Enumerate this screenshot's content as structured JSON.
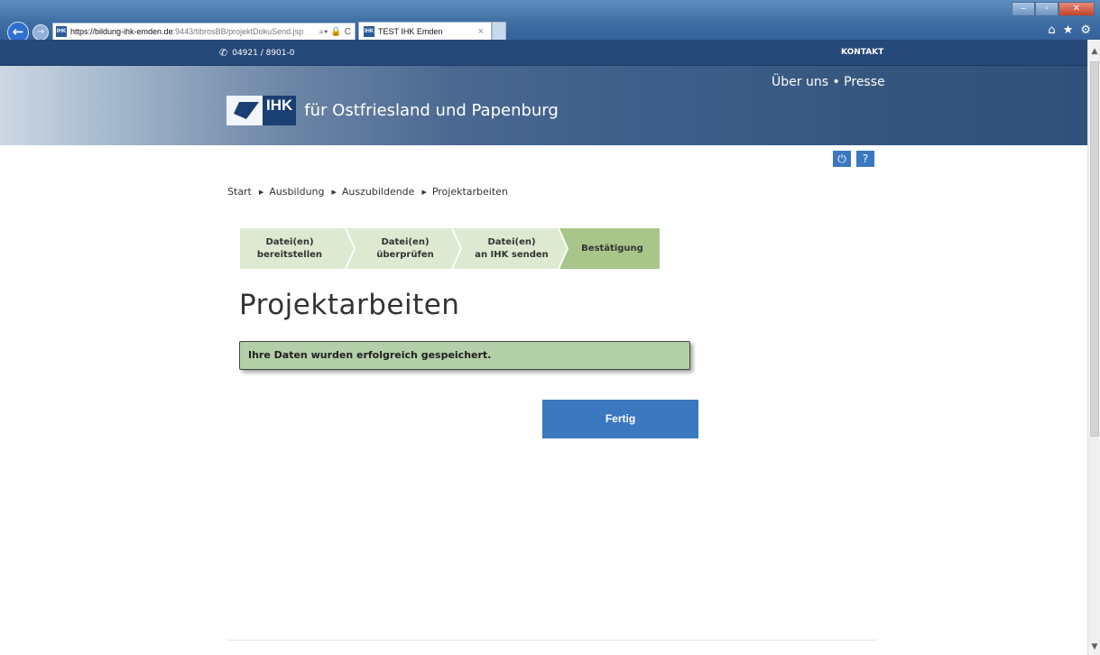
{
  "browser": {
    "url_host": "https://bildung-ihk-emden.de",
    "url_path": ":9443/tibrosBB/projektDokuSend.jsp",
    "site_favicon": "IHK",
    "tab_title": "TEST IHK Emden",
    "tab_close": "×",
    "address_tools": [
      "⌕▾",
      "🔒",
      "C"
    ],
    "window_buttons": [
      "–",
      "▫",
      "✕"
    ],
    "tool_icons": [
      "home-icon",
      "star-icon",
      "gear-icon"
    ],
    "tool_glyphs": [
      "⌂",
      "★",
      "⚙"
    ]
  },
  "topbar": {
    "phone": "04921 / 8901-0",
    "kontakt": "KONTAKT"
  },
  "header": {
    "logo_abbr": "IHK",
    "logo_text": "für Ostfriesland und Papenburg",
    "link_about": "Über uns",
    "link_sep": " • ",
    "link_press": "Presse"
  },
  "util": {
    "power_icon": "⏻",
    "help_icon": "?"
  },
  "breadcrumb": [
    "Start",
    "Ausbildung",
    "Auszubildende",
    "Projektarbeiten"
  ],
  "steps": [
    {
      "line1": "Datei(en)",
      "line2": "bereitstellen",
      "active": false
    },
    {
      "line1": "Datei(en)",
      "line2": "überprüfen",
      "active": false
    },
    {
      "line1": "Datei(en)",
      "line2": "an IHK senden",
      "active": false
    },
    {
      "line1": "Bestätigung",
      "line2": "",
      "active": true
    }
  ],
  "main": {
    "title": "Projektarbeiten",
    "success_message": "Ihre Daten wurden erfolgreich gespeichert.",
    "fertig_label": "Fertig"
  },
  "colors": {
    "topbar": "#26497a",
    "accent_button": "#3b78c0",
    "step_inactive": "#dde9d1",
    "step_active": "#a8c68a",
    "success_bg": "#b3cfa8"
  }
}
